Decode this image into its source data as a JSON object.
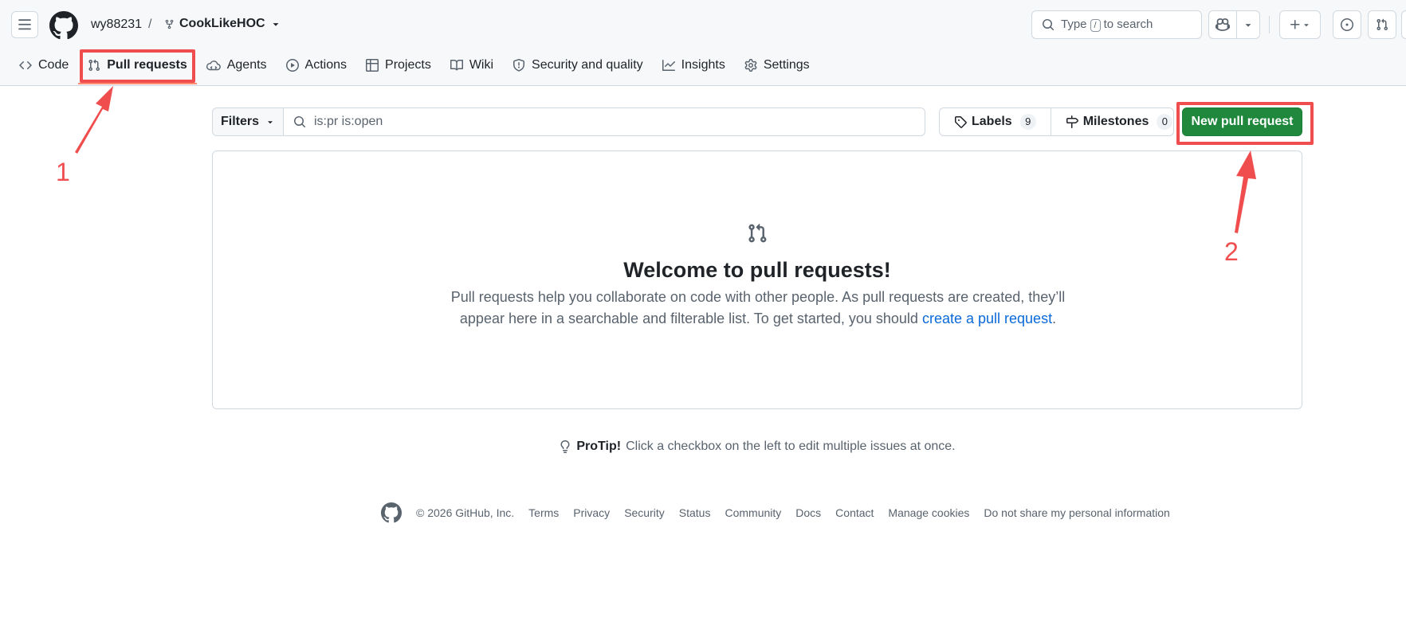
{
  "header": {
    "owner": "wy88231",
    "separator": "/",
    "repo": "CookLikeHOC",
    "search_prefix": "Type",
    "search_key": "/",
    "search_suffix": "to search"
  },
  "tabs": [
    {
      "label": "Code",
      "icon": "code-icon"
    },
    {
      "label": "Pull requests",
      "icon": "git-pull-request-icon"
    },
    {
      "label": "Agents",
      "icon": "agents-icon"
    },
    {
      "label": "Actions",
      "icon": "play-icon"
    },
    {
      "label": "Projects",
      "icon": "table-icon"
    },
    {
      "label": "Wiki",
      "icon": "book-icon"
    },
    {
      "label": "Security and quality",
      "icon": "shield-icon"
    },
    {
      "label": "Insights",
      "icon": "graph-icon"
    },
    {
      "label": "Settings",
      "icon": "gear-icon"
    }
  ],
  "toolbar": {
    "filters_label": "Filters",
    "filter_value": "is:pr is:open",
    "labels_label": "Labels",
    "labels_count": "9",
    "milestones_label": "Milestones",
    "milestones_count": "0",
    "new_pr_label": "New pull request"
  },
  "blankslate": {
    "title": "Welcome to pull requests!",
    "text_part1": "Pull requests help you collaborate on code with other people. As pull requests are created, they’ll appear here in a searchable and filterable list. To get started, you should",
    "link": "create a pull request",
    "text_end": "."
  },
  "protip": {
    "bold": "ProTip!",
    "text": "Click a checkbox on the left to edit multiple issues at once."
  },
  "footer": {
    "copyright": "© 2026 GitHub, Inc.",
    "links": [
      "Terms",
      "Privacy",
      "Security",
      "Status",
      "Community",
      "Docs",
      "Contact",
      "Manage cookies",
      "Do not share my personal information"
    ]
  },
  "annotations": {
    "label1": "1",
    "label2": "2",
    "color": "#f04e4e"
  },
  "colors": {
    "primary_button": "#1f883d",
    "link": "#0969da",
    "active_tab_underline": "#fd8c73"
  }
}
